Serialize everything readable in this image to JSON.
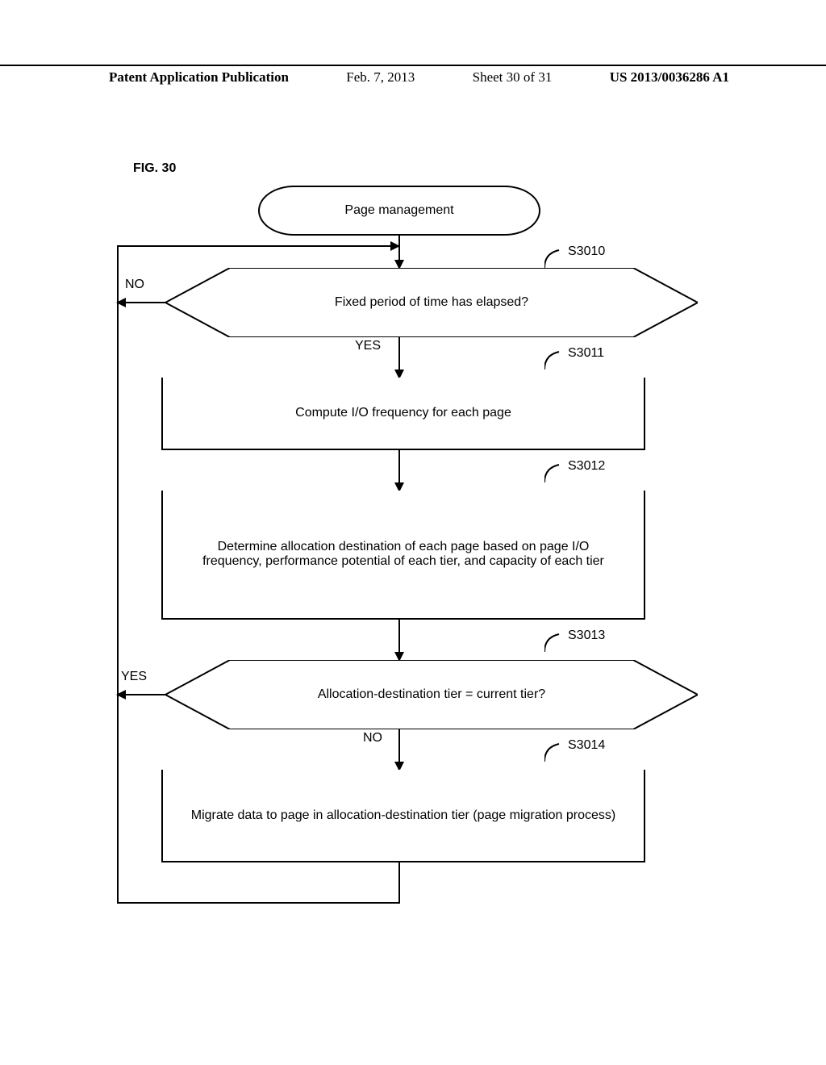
{
  "header": {
    "publication": "Patent Application Publication",
    "date": "Feb. 7, 2013",
    "sheet": "Sheet 30 of 31",
    "pubnum": "US 2013/0036286 A1"
  },
  "figure_label": "FIG. 30",
  "chart_data": {
    "type": "flowchart",
    "title": "Page management",
    "nodes": [
      {
        "id": "start",
        "type": "terminator",
        "text": "Page management"
      },
      {
        "id": "S3010",
        "type": "decision",
        "text": "Fixed period of time has elapsed?",
        "label": "S3010"
      },
      {
        "id": "S3011",
        "type": "process",
        "text": "Compute I/O frequency for each page",
        "label": "S3011"
      },
      {
        "id": "S3012",
        "type": "process",
        "text": "Determine allocation destination of each page based on page I/O frequency, performance potential of each tier, and capacity of each tier",
        "label": "S3012"
      },
      {
        "id": "S3013",
        "type": "decision",
        "text": "Allocation-destination tier = current tier?",
        "label": "S3013"
      },
      {
        "id": "S3014",
        "type": "process",
        "text": "Migrate data to page in allocation-destination tier (page migration process)",
        "label": "S3014"
      }
    ],
    "edges": [
      {
        "from": "start",
        "to": "S3010"
      },
      {
        "from": "S3010",
        "to": "S3011",
        "label": "YES"
      },
      {
        "from": "S3010",
        "to": "S3010",
        "label": "NO",
        "loopback": true
      },
      {
        "from": "S3011",
        "to": "S3012"
      },
      {
        "from": "S3012",
        "to": "S3013"
      },
      {
        "from": "S3013",
        "to": "S3014",
        "label": "NO"
      },
      {
        "from": "S3013",
        "to": "S3010",
        "label": "YES",
        "loopback": true
      },
      {
        "from": "S3014",
        "to": "S3010",
        "loopback": true
      }
    ]
  },
  "labels": {
    "yes": "YES",
    "no": "NO",
    "s3010": "S3010",
    "s3011": "S3011",
    "s3012": "S3012",
    "s3013": "S3013",
    "s3014": "S3014"
  }
}
